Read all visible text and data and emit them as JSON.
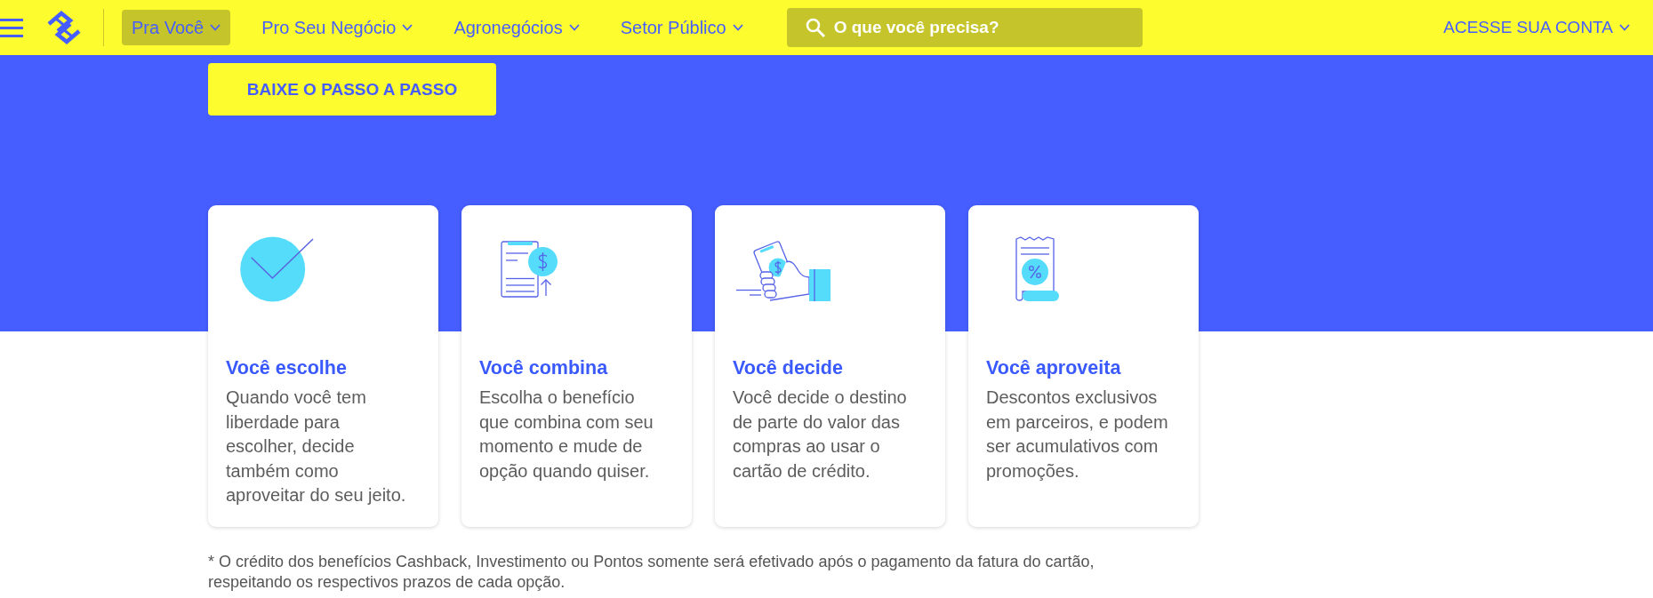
{
  "header": {
    "nav": [
      {
        "label": "Pra Você",
        "selected": true
      },
      {
        "label": "Pro Seu Negócio",
        "selected": false
      },
      {
        "label": "Agronegócios",
        "selected": false
      },
      {
        "label": "Setor Público",
        "selected": false
      }
    ],
    "search": {
      "placeholder": "O que você precisa?"
    },
    "account_menu": {
      "label": "ACESSE SUA CONTA"
    }
  },
  "hero": {
    "button": "BAIXE O PASSO A PASSO"
  },
  "cards": [
    {
      "kind": "check",
      "title": "Você escolhe",
      "text": "Quando você tem liberdade para escolher, decide também como aproveitar do seu jeito."
    },
    {
      "kind": "invoice",
      "title": "Você combina",
      "text": "Escolha o benefício que combina com seu momento e mude de opção quando quiser."
    },
    {
      "kind": "payment",
      "title": "Você decide",
      "text": "Você decide o destino de parte do valor das compras ao usar o cartão de crédito."
    },
    {
      "kind": "receipt",
      "title": "Você aproveita",
      "text": "Descontos exclusivos em parceiros, e podem ser acumulativos com promoções."
    }
  ],
  "footnote": "* O crédito dos benefícios Cashback, Investimento ou Pontos somente será efetivado após o pagamento da fatura do cartão, respeitando os respectivos prazos de cada opção."
}
